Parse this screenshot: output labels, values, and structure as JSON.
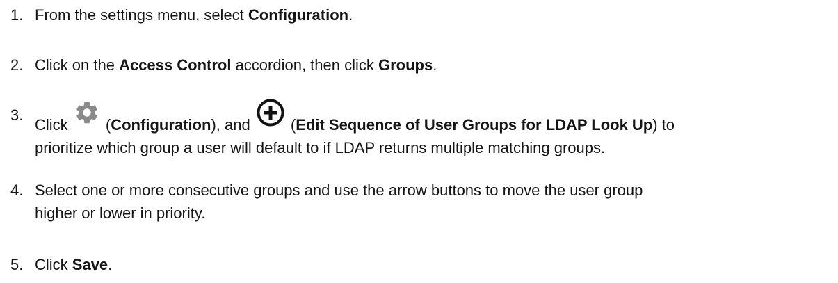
{
  "steps": [
    {
      "number": "1.",
      "parts": {
        "a": "From the settings menu, select ",
        "b": "Configuration",
        "c": "."
      }
    },
    {
      "number": "2.",
      "parts": {
        "a": "Click on the ",
        "b": "Access Control",
        "c": " accordion, then click ",
        "d": "Groups",
        "e": "."
      }
    },
    {
      "number": "3.",
      "parts": {
        "a": "Click ",
        "b": " (",
        "c": "Configuration",
        "d": "), and ",
        "e": " (",
        "f": "Edit Sequence of User Groups for LDAP Look Up",
        "g": ") to",
        "h": "prioritize which group a user will default to if LDAP returns multiple matching groups."
      },
      "icons": [
        "gear-icon",
        "plus-circle-icon"
      ]
    },
    {
      "number": "4.",
      "parts": {
        "a": "Select one or more consecutive groups and use the arrow buttons to move the user group",
        "b": "higher or lower in priority."
      }
    },
    {
      "number": "5.",
      "parts": {
        "a": "Click ",
        "b": "Save",
        "c": "."
      }
    }
  ],
  "colors": {
    "text": "#151515",
    "gear_icon": "#8a8a8a",
    "plus_icon": "#111111"
  }
}
